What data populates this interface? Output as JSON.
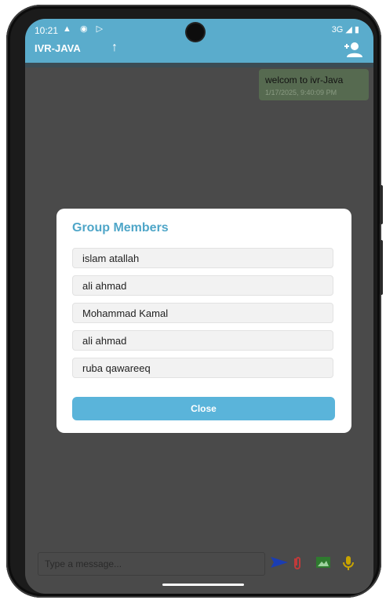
{
  "status": {
    "time": "10:21",
    "icons": "▲ ◉ ▷",
    "right": "3G ◢ ▮"
  },
  "app": {
    "title": "IVR-JAVA",
    "up_icon": "arrow-up-icon",
    "add_user_icon": "add-user-icon"
  },
  "message": {
    "text": "welcom to ivr-Java",
    "time": "1/17/2025, 9:40:09 PM"
  },
  "dialog": {
    "title": "Group Members",
    "members": [
      "islam atallah",
      "ali ahmad",
      "Mohammad Kamal",
      "ali ahmad",
      "ruba qawareeq"
    ],
    "close_label": "Close"
  },
  "composer": {
    "placeholder": "Type a message..."
  },
  "colors": {
    "accent": "#5aaccc",
    "button": "#5ab4da",
    "send": "#1a3db3",
    "attach": "#c13a3a",
    "image": "#2f7a2f",
    "mic": "#c8a400"
  }
}
